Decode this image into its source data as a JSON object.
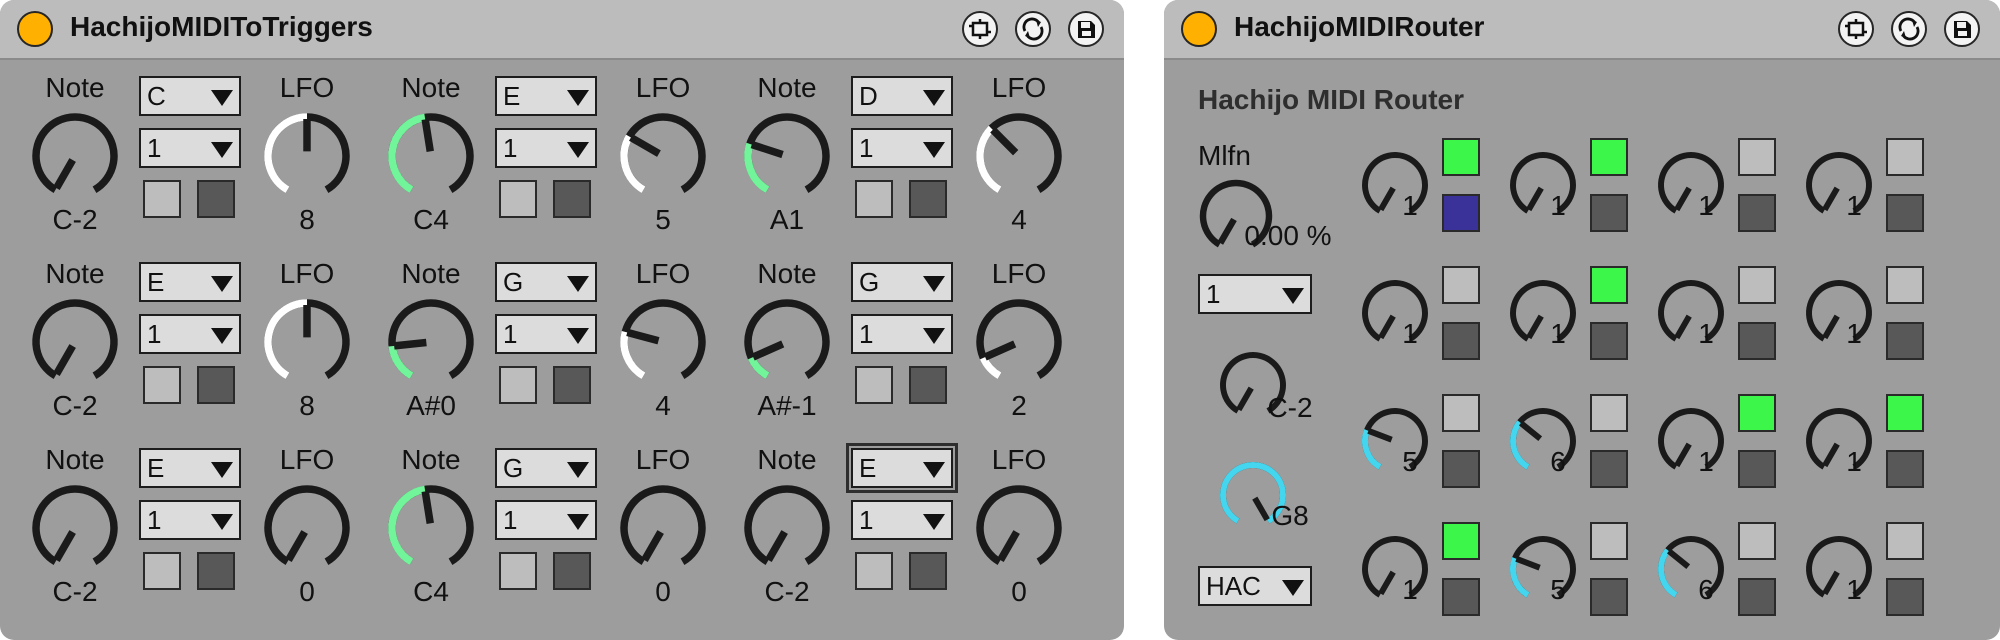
{
  "colors": {
    "panel": "#9d9d9d",
    "titlebar": "#bcbcbc",
    "power": "#ffb000",
    "knob_off": "#1a1a1a",
    "knob_on_green": "#72f59a",
    "knob_on_white": "#ffffff",
    "knob_on_cyan": "#44d6ee",
    "button_light": "#bdbdbd",
    "button_dark": "#585858",
    "button_green": "#3cf64a",
    "button_blue": "#3a3199"
  },
  "device1": {
    "title": "HachijoMIDIToTriggers",
    "icons": [
      "power-icon",
      "hotswap-icon",
      "refresh-icon",
      "save-icon"
    ],
    "cells": [
      {
        "note_label": "Note",
        "lfo_label": "LFO",
        "note_select": "C",
        "channel_select": "1",
        "note_value": "C-2",
        "note_knob": 0,
        "lfo_value": "8",
        "lfo_knob": 0.5,
        "button_a": "light",
        "button_b": "dark"
      },
      {
        "note_label": "Note",
        "lfo_label": "LFO",
        "note_select": "E",
        "channel_select": "1",
        "note_value": "C4",
        "note_knob": 0.47,
        "lfo_value": "5",
        "lfo_knob": 0.3,
        "button_a": "light",
        "button_b": "dark"
      },
      {
        "note_label": "Note",
        "lfo_label": "LFO",
        "note_select": "D",
        "channel_select": "1",
        "note_value": "A1",
        "note_knob": 0.26,
        "lfo_value": "4",
        "lfo_knob": 0.35,
        "button_a": "light",
        "button_b": "dark"
      },
      {
        "note_label": "Note",
        "lfo_label": "LFO",
        "note_select": "E",
        "channel_select": "1",
        "note_value": "C-2",
        "note_knob": 0,
        "lfo_value": "8",
        "lfo_knob": 0.5,
        "button_a": "light",
        "button_b": "dark"
      },
      {
        "note_label": "Note",
        "lfo_label": "LFO",
        "note_select": "G",
        "channel_select": "1",
        "note_value": "A#0",
        "note_knob": 0.18,
        "lfo_value": "4",
        "lfo_knob": 0.25,
        "button_a": "light",
        "button_b": "dark"
      },
      {
        "note_label": "Note",
        "lfo_label": "LFO",
        "note_select": "G",
        "channel_select": "1",
        "note_value": "A#-1",
        "note_knob": 0.12,
        "lfo_value": "2",
        "lfo_knob": 0.12,
        "button_a": "light",
        "button_b": "dark"
      },
      {
        "note_label": "Note",
        "lfo_label": "LFO",
        "note_select": "E",
        "channel_select": "1",
        "note_value": "C-2",
        "note_knob": 0,
        "lfo_value": "0",
        "lfo_knob": 0,
        "button_a": "light",
        "button_b": "dark"
      },
      {
        "note_label": "Note",
        "lfo_label": "LFO",
        "note_select": "G",
        "channel_select": "1",
        "note_value": "C4",
        "note_knob": 0.47,
        "lfo_value": "0",
        "lfo_knob": 0,
        "button_a": "light",
        "button_b": "dark"
      },
      {
        "note_label": "Note",
        "lfo_label": "LFO",
        "note_select": "E",
        "channel_select": "1",
        "note_value": "C-2",
        "note_knob": 0,
        "lfo_value": "0",
        "lfo_knob": 0,
        "button_a": "light",
        "button_b": "dark",
        "focused": true
      }
    ]
  },
  "device2": {
    "title": "HachijoMIDIRouter",
    "icons": [
      "power-icon",
      "hotswap-icon",
      "refresh-icon",
      "save-icon"
    ],
    "subtitle": "Hachijo MIDI Router",
    "mlfn_label": "Mlfn",
    "mlfn_value": "0.00 %",
    "mlfn_knob": 0,
    "channel_select": "1",
    "note_value": "C-2",
    "note_knob": 0,
    "pitch_value": "G8",
    "pitch_knob": 1,
    "mode_select": "HAC",
    "grid": [
      [
        {
          "value": "1",
          "knob": 0,
          "top": "on",
          "bottom": "blue"
        },
        {
          "value": "1",
          "knob": 0,
          "top": "on",
          "bottom": "dark"
        },
        {
          "value": "1",
          "knob": 0,
          "top": "light",
          "bottom": "dark"
        },
        {
          "value": "1",
          "knob": 0,
          "top": "light",
          "bottom": "dark"
        }
      ],
      [
        {
          "value": "1",
          "knob": 0,
          "top": "light",
          "bottom": "dark"
        },
        {
          "value": "1",
          "knob": 0,
          "top": "on",
          "bottom": "dark"
        },
        {
          "value": "1",
          "knob": 0,
          "top": "light",
          "bottom": "dark"
        },
        {
          "value": "1",
          "knob": 0,
          "top": "light",
          "bottom": "dark"
        }
      ],
      [
        {
          "value": "5",
          "knob": 0.27,
          "top": "light",
          "bottom": "dark"
        },
        {
          "value": "6",
          "knob": 0.33,
          "top": "light",
          "bottom": "dark"
        },
        {
          "value": "1",
          "knob": 0,
          "top": "on",
          "bottom": "dark"
        },
        {
          "value": "1",
          "knob": 0,
          "top": "on",
          "bottom": "dark"
        }
      ],
      [
        {
          "value": "1",
          "knob": 0,
          "top": "on",
          "bottom": "dark"
        },
        {
          "value": "5",
          "knob": 0.27,
          "top": "light",
          "bottom": "dark"
        },
        {
          "value": "6",
          "knob": 0.33,
          "top": "light",
          "bottom": "dark"
        },
        {
          "value": "1",
          "knob": 0,
          "top": "light",
          "bottom": "dark"
        }
      ]
    ]
  }
}
